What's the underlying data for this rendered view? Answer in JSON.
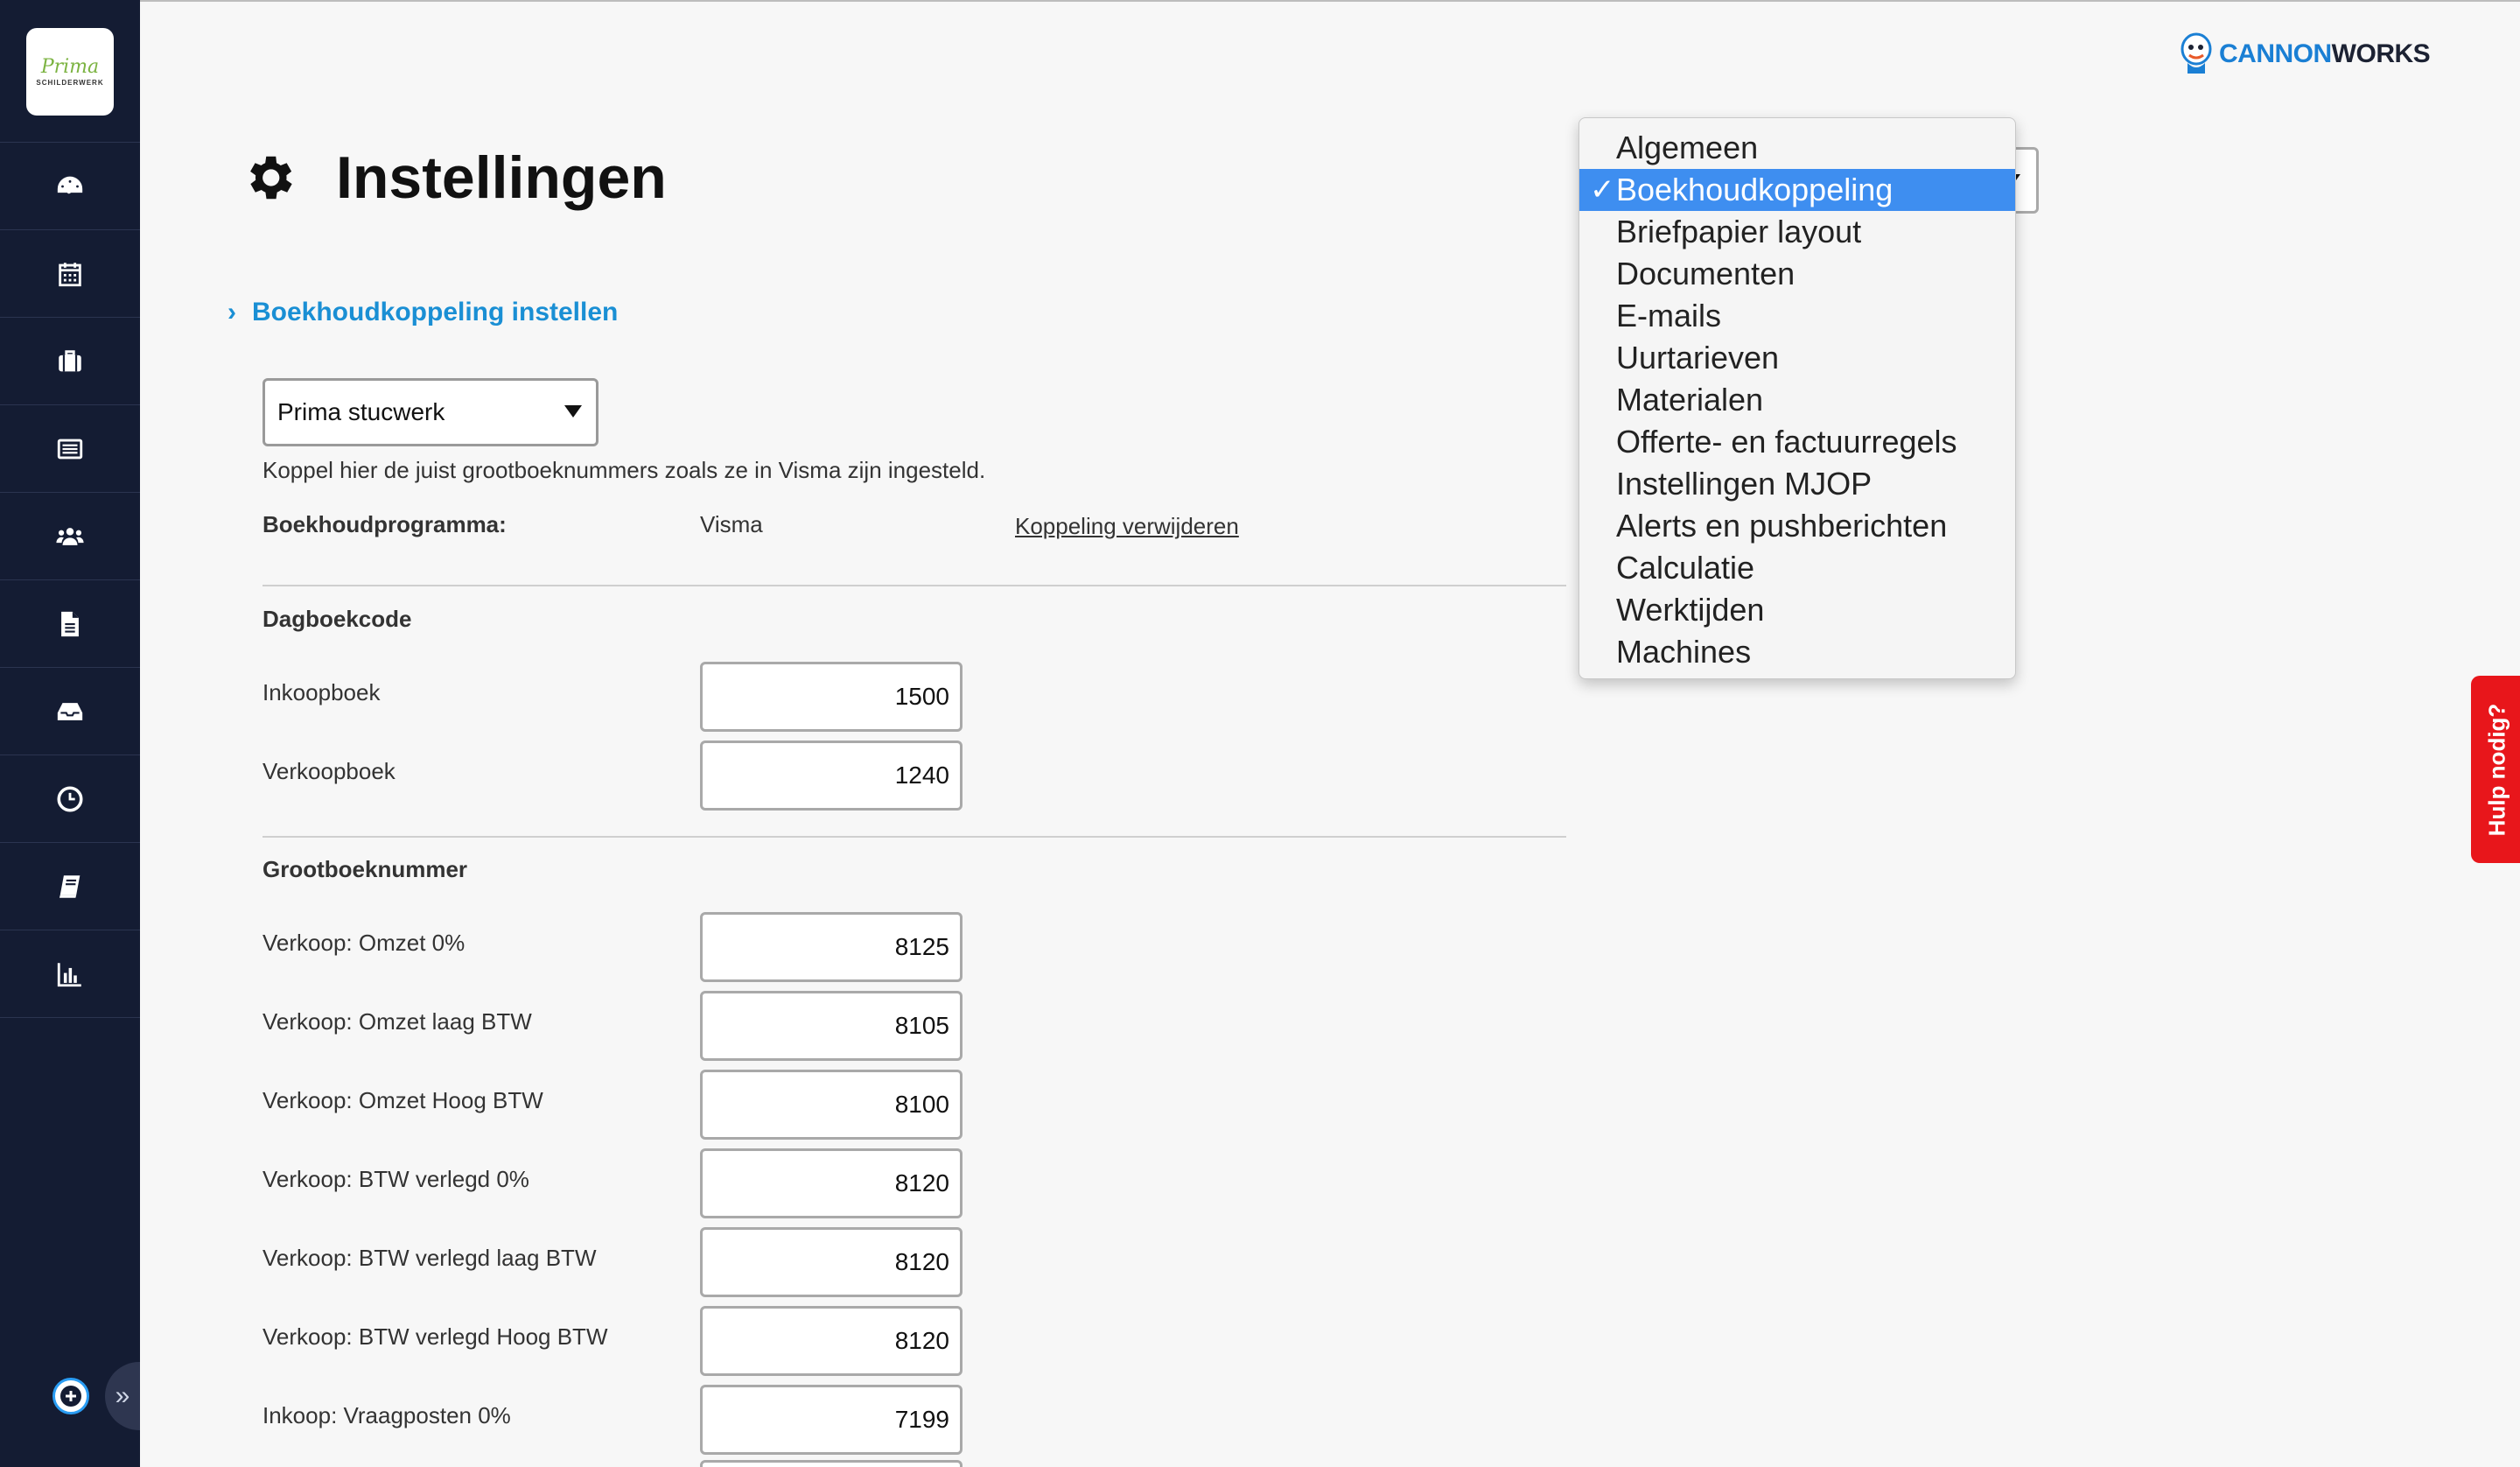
{
  "brand": {
    "logo_main": "Prima",
    "logo_sub": "SCHILDERWERK",
    "cannon": "CANNON",
    "works": "WORKS"
  },
  "sidebar": {
    "items": [
      {
        "name": "dashboard-icon"
      },
      {
        "name": "calendar-icon"
      },
      {
        "name": "briefcase-icon"
      },
      {
        "name": "list-icon"
      },
      {
        "name": "users-icon"
      },
      {
        "name": "document-icon"
      },
      {
        "name": "inbox-icon"
      },
      {
        "name": "clock-icon"
      },
      {
        "name": "book-icon"
      },
      {
        "name": "chart-icon"
      }
    ],
    "expand_label": "»"
  },
  "page": {
    "title": "Instellingen",
    "section_link": "Boekhoudkoppeling instellen",
    "company_select": "Prima stucwerk",
    "help_text": "Koppel hier de juist grootboeknummers zoals ze in Visma zijn ingesteld.",
    "program_label": "Boekhoudprogramma:",
    "program_value": "Visma",
    "remove_link": "Koppeling verwijderen",
    "dagboek_heading": "Dagboekcode",
    "grootboek_heading": "Grootboeknummer"
  },
  "dagboek_rows": [
    {
      "label": "Inkoopboek",
      "value": "1500"
    },
    {
      "label": "Verkoopboek",
      "value": "1240"
    }
  ],
  "grootboek_rows": [
    {
      "label": "Verkoop: Omzet 0%",
      "value": "8125"
    },
    {
      "label": "Verkoop: Omzet laag BTW",
      "value": "8105"
    },
    {
      "label": "Verkoop: Omzet Hoog BTW",
      "value": "8100"
    },
    {
      "label": "Verkoop: BTW verlegd 0%",
      "value": "8120"
    },
    {
      "label": "Verkoop: BTW verlegd laag BTW",
      "value": "8120"
    },
    {
      "label": "Verkoop: BTW verlegd Hoog BTW",
      "value": "8120"
    },
    {
      "label": "Inkoop: Vraagposten 0%",
      "value": "7199"
    }
  ],
  "settings_menu": {
    "selected": "Boekhoudkoppeling",
    "check": "✓",
    "options": [
      "Algemeen",
      "Boekhoudkoppeling",
      "Briefpapier layout",
      "Documenten",
      "E-mails",
      "Uurtarieven",
      "Materialen",
      "Offerte- en factuurregels",
      "Instellingen MJOP",
      "Alerts en pushberichten",
      "Calculatie",
      "Werktijden",
      "Machines"
    ]
  },
  "help_tab": "Hulp nodig?",
  "colors": {
    "sidebar": "#141c33",
    "accent": "#1a8fd4",
    "selected": "#3e8ef0",
    "help": "#e8161b"
  }
}
